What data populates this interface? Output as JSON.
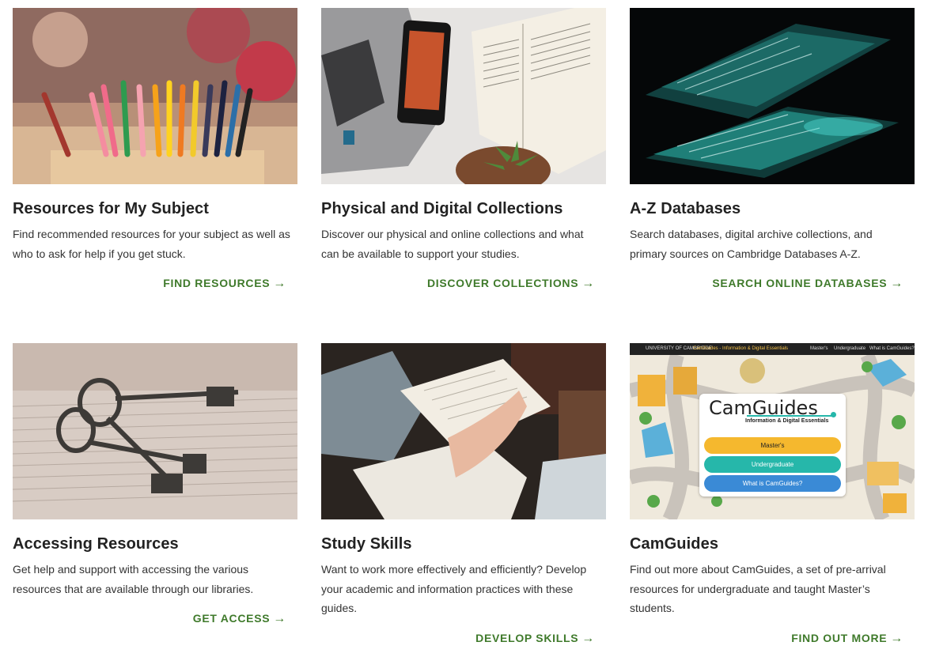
{
  "cards": [
    {
      "title": "Resources for My Subject",
      "description": "Find recommended resources for your subject as well as who to ask for help if you get stuck.",
      "cta": "FIND RESOURCES",
      "image": "coloured pencils in a wooden holder"
    },
    {
      "title": "Physical and Digital Collections",
      "description": "Discover our physical and online collections and what can be available to support your studies.",
      "cta": "DISCOVER COLLECTIONS",
      "image": "laptop, phone and open book on a bed"
    },
    {
      "title": "A-Z Databases",
      "description": "Search databases, digital archive collections, and primary sources on Cambridge Databases A-Z.",
      "cta": "SEARCH ONLINE DATABASES",
      "image": "illuminated laptop keyboard"
    },
    {
      "title": "Accessing Resources",
      "description": "Get help and support with accessing the various resources that are available through our libraries.",
      "cta": "GET ACCESS",
      "image": "old keys on an open book"
    },
    {
      "title": "Study Skills",
      "description": "Want to work more effectively and efficiently? Develop your academic and information practices with these guides.",
      "cta": "DEVELOP SKILLS",
      "image": "person reading and annotating a book"
    },
    {
      "title": "CamGuides",
      "description": "Find out more about CamGuides, a set of pre-arrival resources for undergraduate and taught Master’s students.",
      "cta": "FIND OUT MORE",
      "image": "CamGuides website preview"
    }
  ],
  "camguides_preview": {
    "university": "UNIVERSITY OF CAMBRIDGE",
    "site_name": "CamGuides - Information & Digital Essentials",
    "nav": [
      "Master's",
      "Undergraduate",
      "What is CamGuides?"
    ],
    "logo": "CamGuides",
    "tagline": "Information & Digital Essentials",
    "buttons": [
      "Master's",
      "Undergraduate",
      "What is CamGuides?"
    ],
    "button_colors": [
      "#f5b82e",
      "#26b7aa",
      "#3a8ad6"
    ]
  },
  "colors": {
    "accent": "#3f7a2b"
  }
}
